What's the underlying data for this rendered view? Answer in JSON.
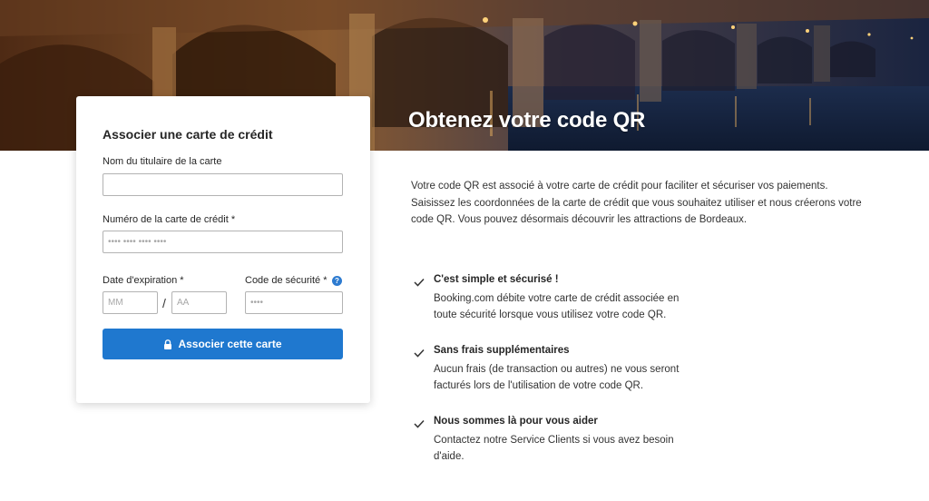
{
  "hero": {
    "title": "Obtenez votre code QR"
  },
  "card": {
    "title": "Associer une carte de crédit",
    "holder_label": "Nom du titulaire de la carte",
    "holder_value": "",
    "number_label": "Numéro de la carte de crédit *",
    "number_placeholder": "•••• •••• •••• ••••",
    "expiry_label": "Date d'expiration *",
    "month_placeholder": "MM",
    "separator": "/",
    "year_placeholder": "AA",
    "security_label": "Code de sécurité *",
    "security_placeholder": "••••",
    "help_glyph": "?",
    "submit_label": "Associer cette carte"
  },
  "info": {
    "description": "Votre code QR est associé à votre carte de crédit pour faciliter et sécuriser vos paiements. Saisissez les coordonnées de la carte de crédit que vous souhaitez utiliser et nous créerons votre code QR. Vous pouvez désormais découvrir les attractions de Bordeaux.",
    "features": [
      {
        "title": "C'est simple et sécurisé !",
        "text": "Booking.com débite votre carte de crédit associée en toute sécurité lorsque vous utilisez votre code QR."
      },
      {
        "title": "Sans frais supplémentaires",
        "text": "Aucun frais (de transaction ou autres) ne vous seront facturés lors de l'utilisation de votre code QR."
      },
      {
        "title": "Nous sommes là pour vous aider",
        "text": "Contactez notre Service Clients si vous avez besoin d'aide."
      }
    ]
  },
  "colors": {
    "accent": "#1f78cf",
    "check": "#333333"
  },
  "icons": {
    "lock": "lock-icon",
    "check": "check-icon",
    "help": "help-icon"
  }
}
